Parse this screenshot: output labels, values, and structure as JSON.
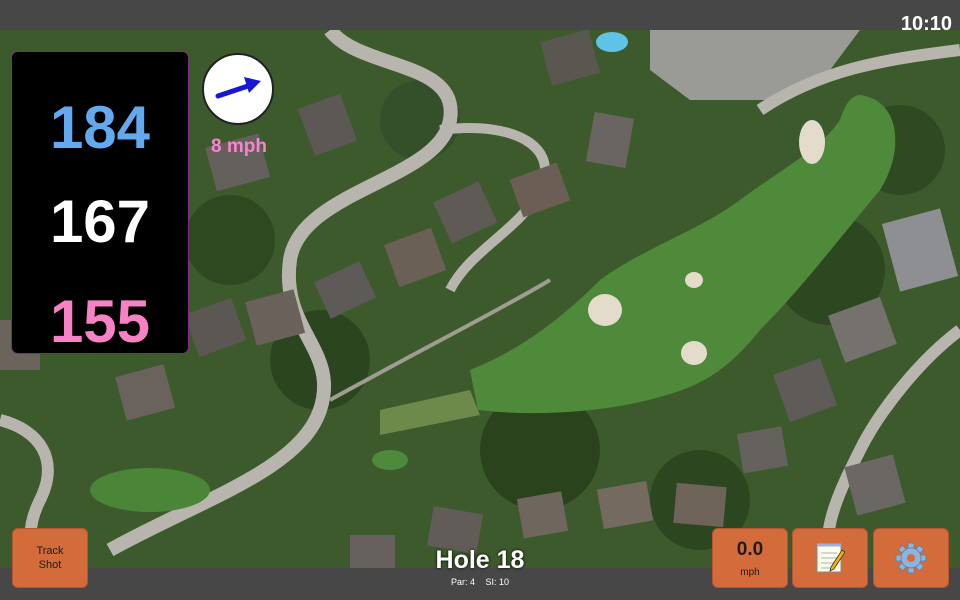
{
  "status_bar": {
    "time": "10:10"
  },
  "distances": {
    "back": "184",
    "middle": "167",
    "front": "155"
  },
  "wind": {
    "speed_label": "8 mph",
    "direction_icon": "arrow-east-icon",
    "gauge_value": "0.0",
    "gauge_unit": "mph"
  },
  "hole": {
    "title": "Hole 18",
    "par": "Par: 4",
    "si": "SI: 10"
  },
  "buttons": {
    "track_line1": "Track",
    "track_line2": "Shot",
    "notes_icon": "notepad-icon",
    "settings_icon": "gear-icon"
  },
  "colors": {
    "accent_button": "#d36b3b",
    "back_distance": "#63a9f0",
    "middle_distance": "#ffffff",
    "front_distance": "#f681c4",
    "wind_text": "#f783d1"
  }
}
